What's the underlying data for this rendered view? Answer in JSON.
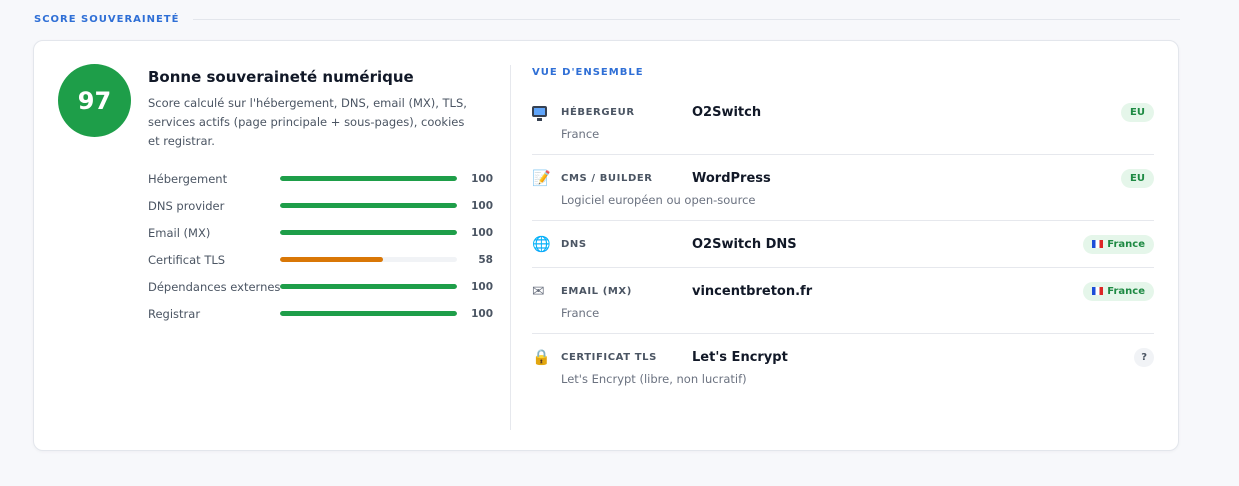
{
  "section": {
    "title": "SCORE SOUVERAINETÉ"
  },
  "score": {
    "value": "97",
    "title": "Bonne souveraineté numérique",
    "description": "Score calculé sur l'hébergement, DNS, email (MX), TLS, services actifs (page principale + sous-pages), cookies et registrar.",
    "bars": [
      {
        "label": "Hébergement",
        "value": 100,
        "value_text": "100",
        "color": "#1e9e49"
      },
      {
        "label": "DNS provider",
        "value": 100,
        "value_text": "100",
        "color": "#1e9e49"
      },
      {
        "label": "Email (MX)",
        "value": 100,
        "value_text": "100",
        "color": "#1e9e49"
      },
      {
        "label": "Certificat TLS",
        "value": 58,
        "value_text": "58",
        "color": "#d97706"
      },
      {
        "label": "Dépendances externes",
        "value": 100,
        "value_text": "100",
        "color": "#1e9e49"
      },
      {
        "label": "Registrar",
        "value": 100,
        "value_text": "100",
        "color": "#1e9e49"
      }
    ]
  },
  "overview": {
    "title": "VUE D'ENSEMBLE",
    "rows": [
      {
        "icon": "monitor-icon",
        "label": "HÉBERGEUR",
        "value": "O2Switch",
        "badge": "EU",
        "sub": "France"
      },
      {
        "icon": "memo-icon",
        "label": "CMS / BUILDER",
        "value": "WordPress",
        "badge": "EU",
        "sub": "Logiciel européen ou open-source"
      },
      {
        "icon": "globe-icon",
        "label": "DNS",
        "value": "O2Switch DNS",
        "badge": "France",
        "sub": ""
      },
      {
        "icon": "envelope-icon",
        "label": "EMAIL (MX)",
        "value": "vincentbreton.fr",
        "badge": "France",
        "sub": "France"
      },
      {
        "icon": "lock-icon",
        "label": "CERTIFICAT TLS",
        "value": "Let's Encrypt",
        "badge": "?",
        "sub": "Let's Encrypt (libre, non lucratif)"
      }
    ]
  },
  "colors": {
    "accent": "#2f6fd6",
    "good": "#1e9e49",
    "warn": "#d97706"
  }
}
